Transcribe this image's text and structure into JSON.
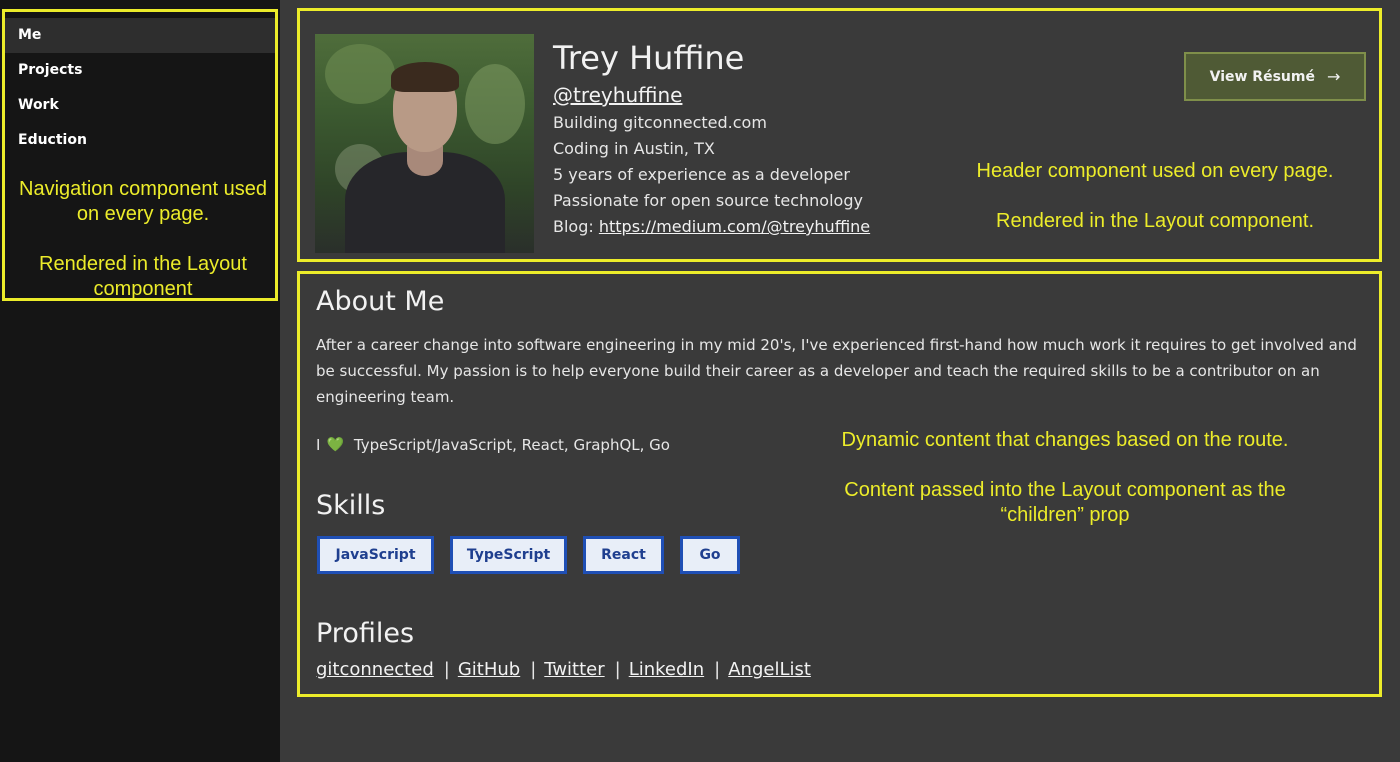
{
  "nav": {
    "items": [
      {
        "label": "Me"
      },
      {
        "label": "Projects"
      },
      {
        "label": "Work"
      },
      {
        "label": "Eduction"
      }
    ],
    "note1": "Navigation component used on every page.",
    "note2": "Rendered in the Layout component"
  },
  "header": {
    "name": "Trey Huffine",
    "handle": "@treyhuffine",
    "line1": "Building gitconnected.com",
    "line2": "Coding in Austin, TX",
    "line3": "5 years of experience as a developer",
    "line4": "Passionate for open source technology",
    "blog_label": "Blog: ",
    "blog_url": "https://medium.com/@treyhuffine",
    "resume_label": "View Résumé",
    "resume_icon": "→",
    "note1": "Header component used on every page.",
    "note2": "Rendered in the Layout component."
  },
  "about": {
    "title": "About Me",
    "text": "After a career change into software engineering in my mid 20's, I've experienced first-hand how much work it requires to get involved and be successful. My passion is to help everyone build their career as a developer and teach the required skills to be a contributor on an engineering team.",
    "love_prefix": "I",
    "love_icon": "💚",
    "love_text": "TypeScript/JavaScript, React, GraphQL, Go"
  },
  "skills": {
    "title": "Skills",
    "items": [
      "JavaScript",
      "TypeScript",
      "React",
      "Go"
    ]
  },
  "profiles": {
    "title": "Profiles",
    "links": [
      "gitconnected",
      "GitHub",
      "Twitter",
      "LinkedIn",
      "AngelList"
    ],
    "separator": "|"
  },
  "content_notes": {
    "note1": "Dynamic content that changes based on the route.",
    "note2": "Content passed into the Layout component as the “children” prop"
  },
  "colors": {
    "annotation": "#ecec2a",
    "sidebar_bg": "#151515",
    "page_bg": "#3a3a3a",
    "skill_border": "#1f4fb5",
    "button_bg": "#4f5a35"
  }
}
